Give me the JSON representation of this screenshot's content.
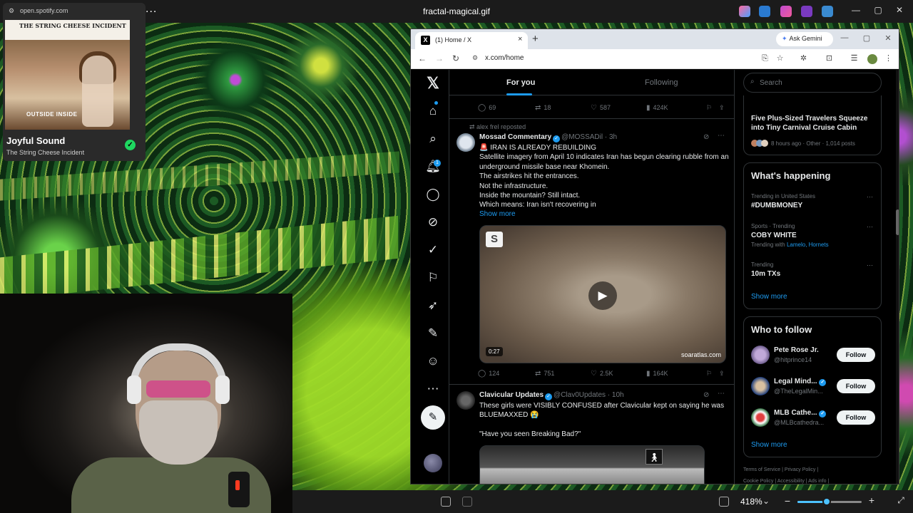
{
  "viewer": {
    "title": "fractal-magical.gif",
    "more_label": "...",
    "zoom": "418%",
    "zoom_level": 0.45,
    "win_min": "—",
    "win_max": "▢",
    "win_close": "✕"
  },
  "spotify": {
    "url": "open.spotify.com",
    "album_band": "THE STRING CHEESE INCIDENT",
    "album_title": "OUTSIDE INSIDE",
    "song": "Joyful Sound",
    "artist": "The String Cheese Incident"
  },
  "chrome": {
    "tab_title": "(1) Home / X",
    "favicon": "X",
    "tab_close": "×",
    "new_tab": "+",
    "ask_gemini": "Ask Gemini",
    "url": "x.com/home",
    "back": "←",
    "forward": "→",
    "reload": "↻"
  },
  "x": {
    "tabs": {
      "for_you": "For you",
      "following": "Following"
    },
    "notification_count": "1",
    "post_icon": "✎",
    "top_actions": {
      "replies": "69",
      "reposts": "18",
      "likes": "587",
      "views": "424K"
    },
    "post1": {
      "repost_label": "alex frel reposted",
      "name": "Mossad Commentary",
      "handle": "@MOSSADil",
      "time": "· 3h",
      "lines": [
        "🚨 IRAN IS ALREADY REBUILDING",
        "Satellite imagery from April 10 indicates Iran has begun clearing rubble from an underground missile base near Khomein.",
        "The airstrikes hit the entrances.",
        "Not the infrastructure.",
        "Inside the mountain? Still intact.",
        "Which means: Iran isn't recovering in"
      ],
      "show_more": "Show more",
      "video_logo": "S",
      "duration": "0:27",
      "watermark": "soaratlas.com",
      "replies": "124",
      "reposts": "751",
      "likes": "2.5K",
      "views": "164K"
    },
    "post2": {
      "name": "Clavicular Updates",
      "handle": "@Clav0Updates",
      "time": "· 10h",
      "lines": [
        "These girls were VISIBLY CONFUSED after Clavicular kept on saying he was BLUEMAXXED 😭",
        "",
        "\"Have you seen Breaking Bad?\""
      ]
    },
    "sidebar": {
      "search_placeholder": "Search",
      "news_title": "Five Plus-Sized Travelers Squeeze into Tiny Carnival Cruise Cabin",
      "news_meta": "8 hours ago · Other · 1,014 posts",
      "happening_title": "What's happening",
      "trends": [
        {
          "context": "Trending in United States",
          "name": "#DUMBMONEY",
          "extra_prefix": "",
          "extra_links": ""
        },
        {
          "context": "Sports · Trending",
          "name": "COBY WHITE",
          "extra_prefix": "Trending with ",
          "extra_links": "Lamelo, Hornets"
        },
        {
          "context": "Trending",
          "name": "10m TXs",
          "extra_prefix": "",
          "extra_links": ""
        }
      ],
      "show_more": "Show more",
      "who_to_follow_title": "Who to follow",
      "follow": [
        {
          "name": "Pete Rose Jr.",
          "handle": "@hitprince14",
          "button": "Follow"
        },
        {
          "name": "Legal Mind...",
          "handle": "@TheLegalMin...",
          "button": "Follow"
        },
        {
          "name": "MLB Cathe...",
          "handle": "@MLBcathedra...",
          "button": "Follow"
        }
      ],
      "show_more_2": "Show more",
      "footer_1": "Terms of Service  |  Privacy Policy  |",
      "footer_2": "Cookie Policy  |  Accessibility  |  Ads info  |"
    }
  }
}
